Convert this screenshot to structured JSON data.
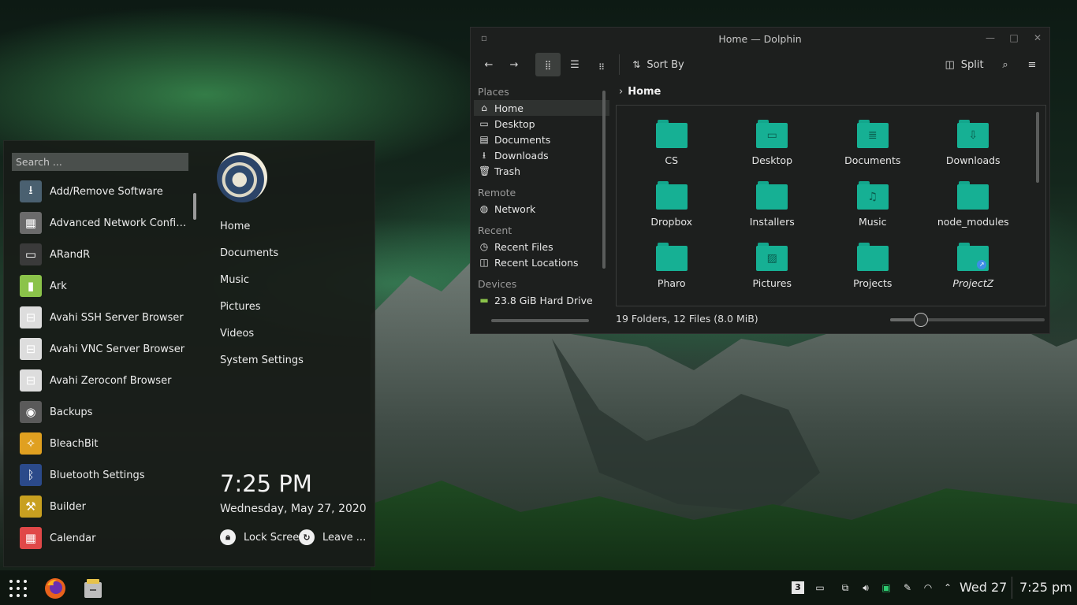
{
  "launcher": {
    "search_placeholder": "Search ...",
    "apps": [
      {
        "label": "Add/Remove Software",
        "icon": "download-icon",
        "color": "#4a6070"
      },
      {
        "label": "Advanced Network Config...",
        "icon": "network-card-icon",
        "color": "#6b6b6b"
      },
      {
        "label": "ARandR",
        "icon": "monitor-icon",
        "color": "#3a3a3a"
      },
      {
        "label": "Ark",
        "icon": "archive-icon",
        "color": "#8bc34a"
      },
      {
        "label": "Avahi SSH Server Browser",
        "icon": "network-computer-icon",
        "color": "#dddddd"
      },
      {
        "label": "Avahi VNC Server Browser",
        "icon": "network-computer-icon",
        "color": "#dddddd"
      },
      {
        "label": "Avahi Zeroconf Browser",
        "icon": "network-computer-icon",
        "color": "#dddddd"
      },
      {
        "label": "Backups",
        "icon": "backup-icon",
        "color": "#5a5a5a"
      },
      {
        "label": "BleachBit",
        "icon": "broom-icon",
        "color": "#e0a020"
      },
      {
        "label": "Bluetooth Settings",
        "icon": "bluetooth-icon",
        "color": "#2b4a8a"
      },
      {
        "label": "Builder",
        "icon": "builder-icon",
        "color": "#c8a020"
      },
      {
        "label": "Calendar",
        "icon": "calendar-icon",
        "color": "#e04848"
      }
    ],
    "places": [
      "Home",
      "Documents",
      "Music",
      "Pictures",
      "Videos",
      "System Settings"
    ],
    "clock": "7:25 PM",
    "date": "Wednesday, May 27, 2020",
    "lock_label": "Lock Screen",
    "leave_label": "Leave ..."
  },
  "dolphin": {
    "title": "Home — Dolphin",
    "toolbar": {
      "sort_by": "Sort By",
      "split": "Split"
    },
    "sidebar": {
      "places_header": "Places",
      "places": [
        {
          "label": "Home",
          "icon": "home-icon",
          "selected": true
        },
        {
          "label": "Desktop",
          "icon": "desktop-icon"
        },
        {
          "label": "Documents",
          "icon": "document-icon"
        },
        {
          "label": "Downloads",
          "icon": "download-icon"
        },
        {
          "label": "Trash",
          "icon": "trash-icon"
        }
      ],
      "remote_header": "Remote",
      "remote": [
        {
          "label": "Network",
          "icon": "network-icon"
        }
      ],
      "recent_header": "Recent",
      "recent": [
        {
          "label": "Recent Files",
          "icon": "clock-icon"
        },
        {
          "label": "Recent Locations",
          "icon": "folder-clock-icon"
        }
      ],
      "devices_header": "Devices",
      "devices": [
        {
          "label": "23.8 GiB Hard Drive",
          "icon": "hard-drive-icon"
        }
      ]
    },
    "breadcrumb": "Home",
    "items": [
      {
        "label": "CS",
        "glyph": ""
      },
      {
        "label": "Desktop",
        "glyph": "▭"
      },
      {
        "label": "Documents",
        "glyph": "≣"
      },
      {
        "label": "Downloads",
        "glyph": "⇩"
      },
      {
        "label": "Dropbox",
        "glyph": ""
      },
      {
        "label": "Installers",
        "glyph": ""
      },
      {
        "label": "Music",
        "glyph": "♫"
      },
      {
        "label": "node_modules",
        "glyph": ""
      },
      {
        "label": "Pharo",
        "glyph": ""
      },
      {
        "label": "Pictures",
        "glyph": "▨"
      },
      {
        "label": "Projects",
        "glyph": ""
      },
      {
        "label": "ProjectZ",
        "glyph": "",
        "symlink": true
      }
    ],
    "status": "19 Folders, 12 Files (8.0 MiB)",
    "zoom_fraction": 0.2
  },
  "panel": {
    "date": "Wed 27",
    "time": "7:25 pm",
    "accent": "#16b094"
  }
}
